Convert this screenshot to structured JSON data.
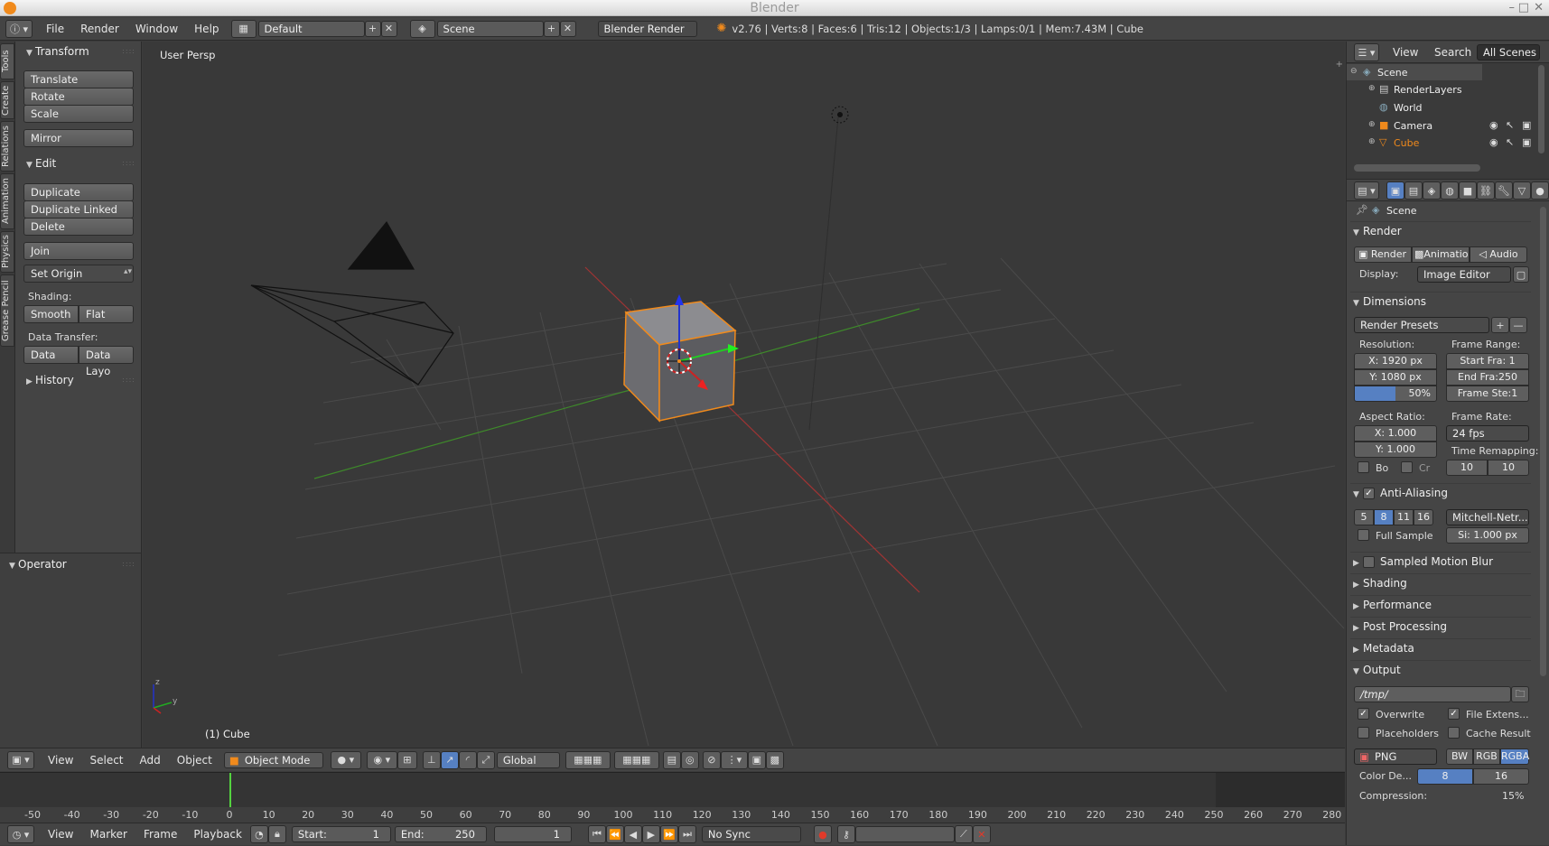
{
  "window_title": "Blender",
  "infobar": {
    "menus": [
      "File",
      "Render",
      "Window",
      "Help"
    ],
    "layout": "Default",
    "scene": "Scene",
    "engine": "Blender Render",
    "stats": "v2.76 | Verts:8 | Faces:6 | Tris:12 | Objects:1/3 | Lamps:0/1 | Mem:7.43M | Cube"
  },
  "left_tabs": [
    "Tools",
    "Create",
    "Relations",
    "Animation",
    "Physics",
    "Grease Pencil"
  ],
  "toolshelf": {
    "transform_title": "Transform",
    "translate": "Translate",
    "rotate": "Rotate",
    "scale": "Scale",
    "mirror": "Mirror",
    "edit_title": "Edit",
    "duplicate": "Duplicate",
    "duplicate_linked": "Duplicate Linked",
    "delete": "Delete",
    "join": "Join",
    "set_origin": "Set Origin",
    "shading_label": "Shading:",
    "smooth": "Smooth",
    "flat": "Flat",
    "data_transfer_label": "Data Transfer:",
    "data": "Data",
    "data_layo": "Data Layo",
    "history_title": "History",
    "operator_title": "Operator"
  },
  "viewport": {
    "view_label": "User Persp",
    "object_label": "(1) Cube"
  },
  "view_header": {
    "menus": [
      "View",
      "Select",
      "Add",
      "Object"
    ],
    "mode": "Object Mode",
    "orientation": "Global"
  },
  "timeline": {
    "ticks": [
      "-50",
      "-40",
      "-30",
      "-20",
      "-10",
      "0",
      "10",
      "20",
      "30",
      "40",
      "50",
      "60",
      "70",
      "80",
      "90",
      "100",
      "110",
      "120",
      "130",
      "140",
      "150",
      "160",
      "170",
      "180",
      "190",
      "200",
      "210",
      "220",
      "230",
      "240",
      "250",
      "260",
      "270",
      "280"
    ],
    "current_frame_value": 0
  },
  "timeline_header": {
    "menus": [
      "View",
      "Marker",
      "Frame",
      "Playback"
    ],
    "start_label": "Start:",
    "start_value": "1",
    "end_label": "End:",
    "end_value": "250",
    "current": "1",
    "sync": "No Sync"
  },
  "outliner": {
    "menus": [
      "View",
      "Search"
    ],
    "filter": "All Scenes",
    "items": [
      "Scene",
      "RenderLayers",
      "World",
      "Camera",
      "Cube"
    ]
  },
  "properties": {
    "context": "Scene",
    "render_title": "Render",
    "render_btn": "Render",
    "animation_btn": "Animatio",
    "audio_btn": "Audio",
    "display_label": "Display:",
    "display_value": "Image Editor",
    "dimensions_title": "Dimensions",
    "render_presets": "Render Presets",
    "resolution_label": "Resolution:",
    "res_x": "X:  1920 px",
    "res_y": "Y:  1080 px",
    "res_pct": "50%",
    "frame_range_label": "Frame Range:",
    "start_frame": "Start Fra:   1",
    "end_frame": "End Fra:250",
    "frame_step": "Frame Ste:1",
    "aspect_label": "Aspect Ratio:",
    "aspect_x": "X:     1.000",
    "aspect_y": "Y:     1.000",
    "frame_rate_label": "Frame Rate:",
    "frame_rate": "24 fps",
    "time_remap_label": "Time Remapping:",
    "remap_old": "10",
    "remap_new": "10",
    "bo_label": "Bo",
    "cr_label": "Cr",
    "aa_title": "Anti-Aliasing",
    "aa_samples": [
      "5",
      "8",
      "11",
      "16"
    ],
    "aa_filter": "Mitchell-Netr...",
    "full_sample": "Full Sample",
    "filter_size": "Si: 1.000 px",
    "motion_blur_title": "Sampled Motion Blur",
    "shading_title": "Shading",
    "performance_title": "Performance",
    "post_processing_title": "Post Processing",
    "metadata_title": "Metadata",
    "output_title": "Output",
    "output_path": "/tmp/",
    "overwrite": "Overwrite",
    "file_extensions": "File Extens...",
    "placeholders": "Placeholders",
    "cache_result": "Cache Result",
    "file_format": "PNG",
    "color_modes": [
      "BW",
      "RGB",
      "RGBA"
    ],
    "color_depth_label": "Color De...",
    "depth_8": "8",
    "depth_16": "16",
    "compression_label": "Compression:",
    "compression_value": "15%"
  },
  "colors": {
    "accent_orange": "#f08a1c",
    "selection_blue": "#5680c2",
    "axis_x": "#a03434",
    "axis_y": "#3e8a2a",
    "frame_green": "#54d23f"
  }
}
